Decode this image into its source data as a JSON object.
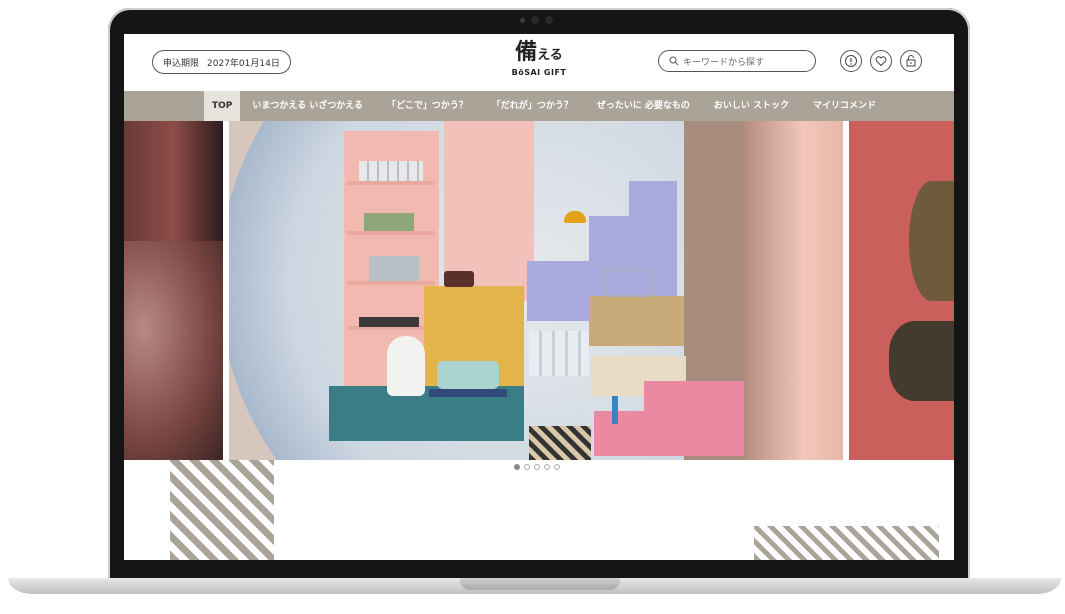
{
  "header": {
    "deadline_label": "申込期限",
    "deadline_date": "2027年01月14日",
    "logo_main": "備",
    "logo_kana": "える",
    "logo_sub": "BōSAI GIFT",
    "search_placeholder": "キーワードから探す"
  },
  "nav": {
    "items": [
      {
        "label": "TOP",
        "active": true
      },
      {
        "label": "いまつかえる いざつかえる"
      },
      {
        "label": "「どこで」つかう？"
      },
      {
        "label": "「だれが」つかう？"
      },
      {
        "label": "ぜったいに 必要なもの"
      },
      {
        "label": "おいしい ストック"
      },
      {
        "label": "マイリコメンド"
      }
    ]
  },
  "carousel": {
    "slide_count": 5,
    "active_index": 0
  },
  "colors": {
    "nav_bg": "#aaa397",
    "active_tab_bg": "#e6e2dc",
    "stripe": "#aaa397"
  },
  "icons": [
    "search-icon",
    "info-icon",
    "heart-icon",
    "lock-icon"
  ]
}
